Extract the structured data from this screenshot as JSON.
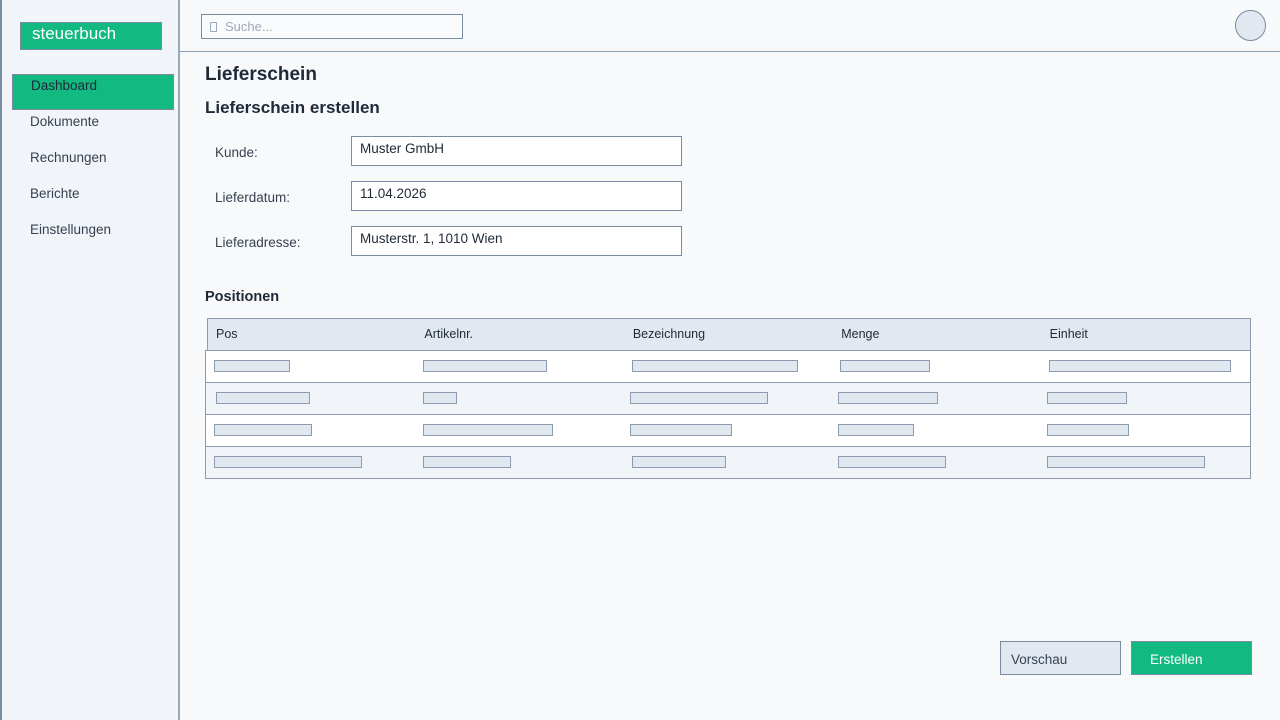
{
  "app": {
    "logo": "steuerbuch"
  },
  "search": {
    "placeholder": "Suche..."
  },
  "sidebar": {
    "items": [
      {
        "label": "Dashboard"
      },
      {
        "label": "Dokumente"
      },
      {
        "label": "Rechnungen"
      },
      {
        "label": "Berichte"
      },
      {
        "label": "Einstellungen"
      }
    ]
  },
  "main": {
    "page_title": "Lieferschein",
    "section_title": "Lieferschein erstellen",
    "form": {
      "customer_label": "Kunde:",
      "customer_value": "Muster GmbH",
      "date_label": "Lieferdatum:",
      "date_value": "11.04.2026",
      "address_label": "Lieferadresse:",
      "address_value": "Musterstr. 1, 1010 Wien"
    },
    "positions_title": "Positionen",
    "table": {
      "columns": [
        "Pos",
        "Artikelnr.",
        "Bezeichnung",
        "Menge",
        "Einheit"
      ]
    }
  },
  "actions": {
    "preview": "Vorschau",
    "create": "Erstellen"
  },
  "colors": {
    "accent": "#12b981",
    "border": "#7b8ba3",
    "header_bg": "#e2e8f0"
  }
}
